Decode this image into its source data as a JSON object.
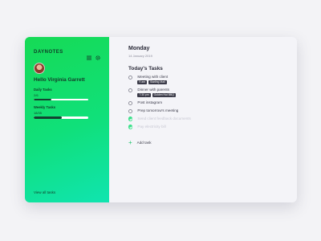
{
  "sidebar": {
    "brand": "DAYNOTES",
    "greeting": "Hello Virginia Garrett",
    "daily": {
      "label": "Daily Tasks",
      "value": "2/6",
      "progress": 0.33
    },
    "weekly": {
      "label": "Weekly Tasks",
      "value": "18/35",
      "progress": 0.51
    },
    "view_all": "View all tasks",
    "icons": [
      "list-icon",
      "gear-icon"
    ]
  },
  "main": {
    "day": "Monday",
    "date": "14 January 2019",
    "section_title": "Today's Tasks",
    "tasks": [
      {
        "title": "Meeting with client",
        "done": false,
        "tags": [
          "9 am",
          "Starling Mall"
        ]
      },
      {
        "title": "Dinner with parents",
        "done": false,
        "tags": [
          "7:30 pm",
          "Golden Hut BBQ"
        ]
      },
      {
        "title": "Post instagram",
        "done": false,
        "tags": []
      },
      {
        "title": "Prep tomorrow's meeting",
        "done": false,
        "tags": []
      },
      {
        "title": "Send client feedback documents",
        "done": true,
        "tags": []
      },
      {
        "title": "Pay electricity bill",
        "done": true,
        "tags": []
      }
    ],
    "add_task": "Add task"
  },
  "colors": {
    "accent": "#16da55",
    "accent_end": "#10e4b0",
    "done": "#3be08a"
  }
}
